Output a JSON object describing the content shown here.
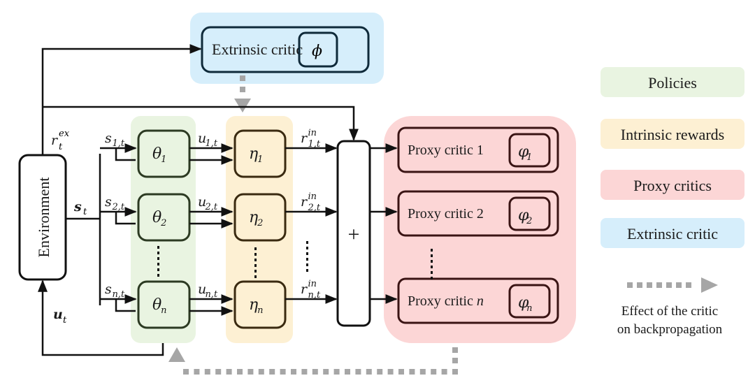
{
  "diagram": {
    "environment": {
      "label": "Environment"
    },
    "extrinsic_critic": {
      "label": "Extrinsic critic",
      "param": "ϕ"
    },
    "sum_node": {
      "label": "+"
    },
    "signals": {
      "r_ex": {
        "base": "r",
        "sup": "ex",
        "sub": "t"
      },
      "s_t": {
        "base": "s",
        "sub": "t"
      },
      "u_t": {
        "base": "u",
        "sub": "t"
      }
    },
    "agents": [
      {
        "state": {
          "base": "s",
          "sub": "1,t"
        },
        "policy": {
          "base": "θ",
          "sub": "1"
        },
        "action": {
          "base": "u",
          "sub": "1,t"
        },
        "reward_net": {
          "base": "η",
          "sub": "1"
        },
        "reward": {
          "base": "r",
          "sup": "in",
          "sub": "1,t"
        },
        "critic": {
          "label": "Proxy critic 1",
          "param_base": "φ",
          "param_sub": "1"
        }
      },
      {
        "state": {
          "base": "s",
          "sub": "2,t"
        },
        "policy": {
          "base": "θ",
          "sub": "2"
        },
        "action": {
          "base": "u",
          "sub": "2,t"
        },
        "reward_net": {
          "base": "η",
          "sub": "2"
        },
        "reward": {
          "base": "r",
          "sup": "in",
          "sub": "2,t"
        },
        "critic": {
          "label": "Proxy critic 2",
          "param_base": "φ",
          "param_sub": "2"
        }
      },
      {
        "state": {
          "base": "s",
          "sub": "n,t"
        },
        "policy": {
          "base": "θ",
          "sub": "n"
        },
        "action": {
          "base": "u",
          "sub": "n,t"
        },
        "reward_net": {
          "base": "η",
          "sub": "n"
        },
        "reward": {
          "base": "r",
          "sup": "in",
          "sub": "n,t"
        },
        "critic": {
          "label": "Proxy critic ",
          "label_italic": "n",
          "param_base": "φ",
          "param_sub": "n"
        }
      }
    ]
  },
  "legend": {
    "items": [
      {
        "label": "Policies",
        "color": "#e9f4e1"
      },
      {
        "label": "Intrinsic rewards",
        "color": "#fdf0d3"
      },
      {
        "label": "Proxy critics",
        "color": "#fcd6d6"
      },
      {
        "label": "Extrinsic critic",
        "color": "#d6eefb"
      }
    ],
    "backprop_line1": "Effect of the critic",
    "backprop_line2": "on backpropagation"
  },
  "colors": {
    "policies": "#e9f4e1",
    "intrinsic": "#fdf0d3",
    "proxy": "#fcd6d6",
    "extrinsic": "#d6eefb",
    "policy_border": "#2c3a22",
    "intrinsic_border": "#3a2a10",
    "proxy_border": "#3a1414",
    "extrinsic_border": "#0f2a3a",
    "backprop_arrow": "#a6a6a6"
  }
}
